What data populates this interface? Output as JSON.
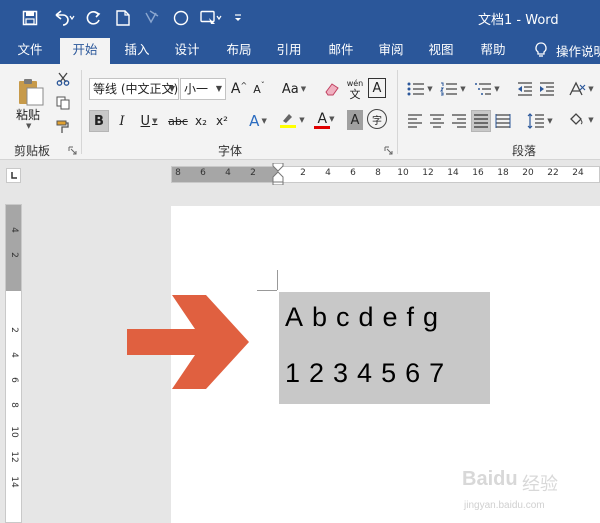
{
  "title_bar": {
    "document_title": "文档1 - Word",
    "quick_access": [
      {
        "name": "save-icon"
      },
      {
        "name": "undo-icon"
      },
      {
        "name": "redo-icon"
      },
      {
        "name": "new-document-icon"
      },
      {
        "name": "format-painter-disabled-icon"
      },
      {
        "name": "circle-shape-icon"
      },
      {
        "name": "touch-mode-icon"
      },
      {
        "name": "customize-toolbar-icon"
      }
    ]
  },
  "tabs": {
    "file": "文件",
    "home": "开始",
    "insert": "插入",
    "design": "设计",
    "layout": "布局",
    "references": "引用",
    "mailings": "邮件",
    "review": "审阅",
    "view": "视图",
    "help": "帮助",
    "tell_me": "操作说明"
  },
  "ribbon": {
    "clipboard": {
      "paste_label": "粘贴",
      "group_label": "剪贴板"
    },
    "font": {
      "font_name": "等线 (中文正文)",
      "font_size": "小一",
      "group_label": "字体",
      "bold": "B",
      "italic": "I",
      "underline": "U",
      "strike": "abc",
      "subscript": "x₂",
      "superscript": "x²",
      "grow": "A",
      "shrink": "A",
      "change_case": "Aa",
      "clear_format": "A",
      "phonetic": "wén",
      "border_char": "A",
      "shading_char": "A",
      "enclose_char": "字",
      "highlight_color": "#ffff00",
      "font_color": "#e00000"
    },
    "paragraph": {
      "group_label": "段落"
    }
  },
  "ruler": {
    "horizontal_numbers": [
      "8",
      "6",
      "4",
      "2",
      "2",
      "4",
      "6",
      "8",
      "10",
      "12",
      "14",
      "16",
      "18",
      "20",
      "22",
      "24"
    ],
    "vertical_numbers": [
      "4",
      "2",
      "2",
      "4",
      "6",
      "8",
      "10",
      "12",
      "14"
    ]
  },
  "document": {
    "line1": "Abcdefg",
    "line2": "1234567",
    "arrow_color": "#e06040"
  },
  "watermark": {
    "brand": "Baidu",
    "cn": "经验",
    "url": "jingyan.baidu.com"
  }
}
